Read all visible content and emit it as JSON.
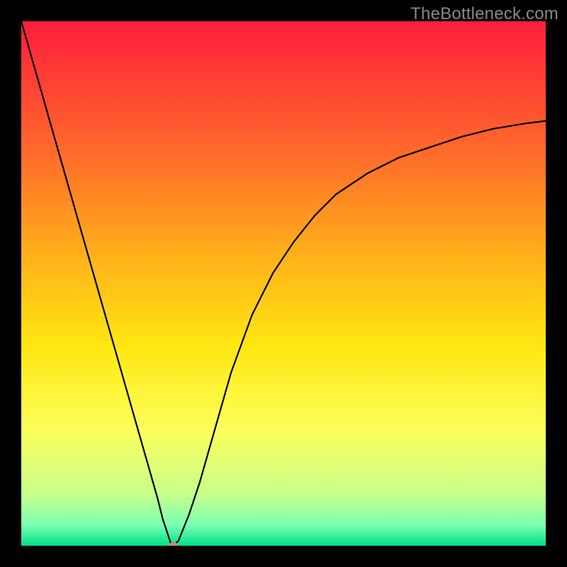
{
  "watermark": "TheBottleneck.com",
  "chart_data": {
    "type": "line",
    "title": "",
    "xlabel": "",
    "ylabel": "",
    "xlim": [
      0,
      100
    ],
    "ylim": [
      0,
      100
    ],
    "grid": false,
    "background_gradient": {
      "stops": [
        {
          "offset": 0.0,
          "color": "#ff1d3b"
        },
        {
          "offset": 0.25,
          "color": "#ff6a2b"
        },
        {
          "offset": 0.45,
          "color": "#ffb219"
        },
        {
          "offset": 0.62,
          "color": "#ffe712"
        },
        {
          "offset": 0.78,
          "color": "#fcff5c"
        },
        {
          "offset": 0.9,
          "color": "#c8ff8a"
        },
        {
          "offset": 0.96,
          "color": "#7cffb2"
        },
        {
          "offset": 1.0,
          "color": "#00e08a"
        }
      ]
    },
    "series": [
      {
        "name": "bottleneck-curve",
        "x": [
          0,
          2,
          4,
          6,
          8,
          10,
          12,
          14,
          16,
          18,
          20,
          22,
          24,
          26,
          27,
          28,
          28.5,
          29,
          30,
          32,
          34,
          36,
          38,
          40,
          44,
          48,
          52,
          56,
          60,
          66,
          72,
          78,
          84,
          90,
          96,
          100
        ],
        "values": [
          100,
          93,
          86,
          79,
          72,
          65,
          58,
          51,
          44,
          37,
          30,
          23,
          16,
          9,
          5,
          2,
          0.5,
          0,
          1,
          6,
          12,
          19,
          26,
          33,
          44,
          52,
          58,
          63,
          67,
          71,
          74,
          76,
          78,
          79.5,
          80.5,
          81
        ]
      }
    ],
    "minimum_marker": {
      "x": 29,
      "y": 0,
      "color": "#d08878",
      "rx": 7,
      "ry": 5
    }
  }
}
